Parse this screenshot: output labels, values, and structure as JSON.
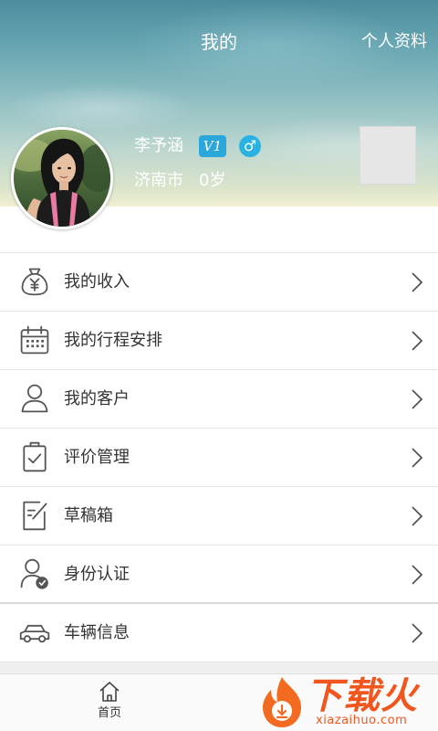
{
  "header": {
    "title": "我的",
    "profile_link": "个人资料"
  },
  "profile": {
    "name": "李予涵",
    "vip_badge": "V1",
    "gender_symbol": "♂",
    "gender_icon": "male-icon",
    "city": "济南市",
    "age": "0岁"
  },
  "menu": {
    "items": [
      {
        "label": "我的收入",
        "icon": "money-bag-icon"
      },
      {
        "label": "我的行程安排",
        "icon": "calendar-icon"
      },
      {
        "label": "我的客户",
        "icon": "person-icon"
      },
      {
        "label": "评价管理",
        "icon": "clipboard-check-icon"
      },
      {
        "label": "草稿箱",
        "icon": "draft-edit-icon"
      },
      {
        "label": "身份认证",
        "icon": "verified-user-icon"
      },
      {
        "label": "车辆信息",
        "icon": "car-icon"
      }
    ],
    "chevron_icon": "chevron-right-icon"
  },
  "bottom_nav": {
    "home_label": "首页",
    "home_icon": "home-icon"
  },
  "watermark": {
    "brand": "下载火",
    "domain": "xiazaihuo.com"
  },
  "colors": {
    "badge_blue": "#2aa8dc",
    "text_primary": "#333333",
    "icon_stroke": "#555555",
    "divider": "#e3e3e3",
    "watermark_orange": "#f0561e"
  }
}
